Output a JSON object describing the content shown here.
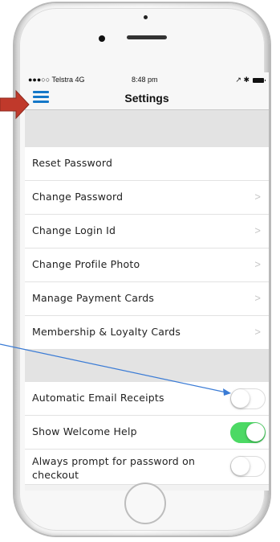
{
  "status_bar": {
    "carrier": "●●●○○ Telstra  4G",
    "time": "8:48 pm",
    "icons": "↗ ✱"
  },
  "navbar": {
    "title": "Settings",
    "menu_icon": "hamburger-menu-icon"
  },
  "settings": {
    "items": [
      {
        "label": "Reset Password"
      },
      {
        "label": "Change Password",
        "chevron": ">"
      },
      {
        "label": "Change Login Id",
        "chevron": ">"
      },
      {
        "label": "Change Profile Photo",
        "chevron": ">"
      },
      {
        "label": "Manage Payment Cards",
        "chevron": ">"
      },
      {
        "label": "Membership & Loyalty Cards",
        "chevron": ">"
      }
    ],
    "toggles": [
      {
        "label": "Automatic Email Receipts",
        "on": false
      },
      {
        "label": "Show Welcome Help",
        "on": true
      },
      {
        "label": "Always prompt for password on checkout",
        "on": false
      }
    ]
  },
  "colors": {
    "accent": "#1478c8",
    "toggle_on": "#4cd964",
    "annotation_arrow": "#c0392b",
    "annotation_line": "#3a7bd5"
  }
}
